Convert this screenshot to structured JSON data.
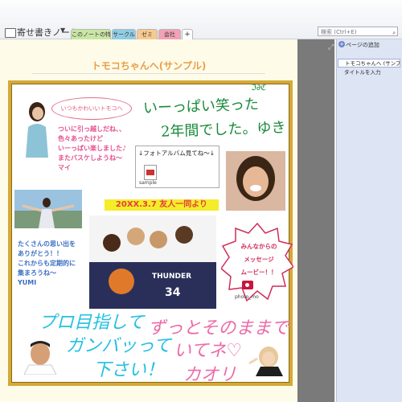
{
  "header": {
    "notebook_title": "寄せ書きノート",
    "tabs": [
      "このノートの特長",
      "サークル",
      "ゼミ",
      "会社",
      "+"
    ],
    "search_placeholder": "検索 (Ctrl+E)"
  },
  "page": {
    "title": "トモコちゃんへ(サンプル)"
  },
  "right_panel": {
    "add_page_label": "ページの追加",
    "pages": [
      "トモコちゃんへ (サンプル)",
      "タイトルを入力"
    ]
  },
  "card": {
    "bubble_text": "いつもかわいいトモコへ",
    "message_mai": [
      "ついに引っ越しだね、、",
      "色々あったけど",
      "いーっぱい楽しました♪",
      "またバスケしようね～",
      "マイ"
    ],
    "handwritten_yuki": [
      "いーっぱい笑った",
      "2年間でした。ゆき"
    ],
    "attachment_label": "↓フォトアルバム見てね～↓",
    "attachment_file": "sample",
    "date_banner": "20XX.3.7 友人一同より",
    "message_yumi": [
      "たくさんの思い出を",
      "ありがとう！！",
      "これからも定期的に",
      "集まろうね～",
      "YUMI"
    ],
    "video_message": [
      "みんなからの",
      "メッセージ",
      "ムービー！！"
    ],
    "video_file": "photo_mo",
    "cyan_hand": [
      "プロ目指して",
      "ガンバッって",
      "下さい！"
    ],
    "pink_hand": [
      "ずっとそのままで",
      "いてネ♡",
      "カオリ"
    ],
    "doodle": "ℑ∂ℭ"
  }
}
